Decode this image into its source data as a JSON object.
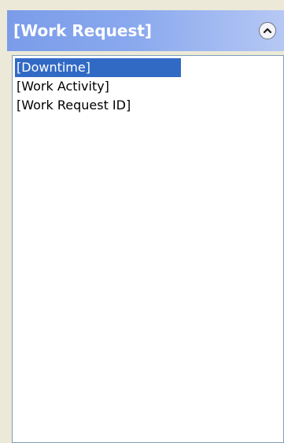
{
  "panel": {
    "title": "[Work Request]",
    "collapse_icon": "chevron-up-circle-icon"
  },
  "list": {
    "items": [
      {
        "label": "[Downtime]",
        "selected": true
      },
      {
        "label": "[Work Activity]",
        "selected": false
      },
      {
        "label": "[Work Request ID]",
        "selected": false
      }
    ]
  },
  "colors": {
    "header_gradient_start": "#7b9ce9",
    "header_gradient_end": "#b6c8f4",
    "selection": "#316ac5",
    "background": "#ece9d8"
  }
}
